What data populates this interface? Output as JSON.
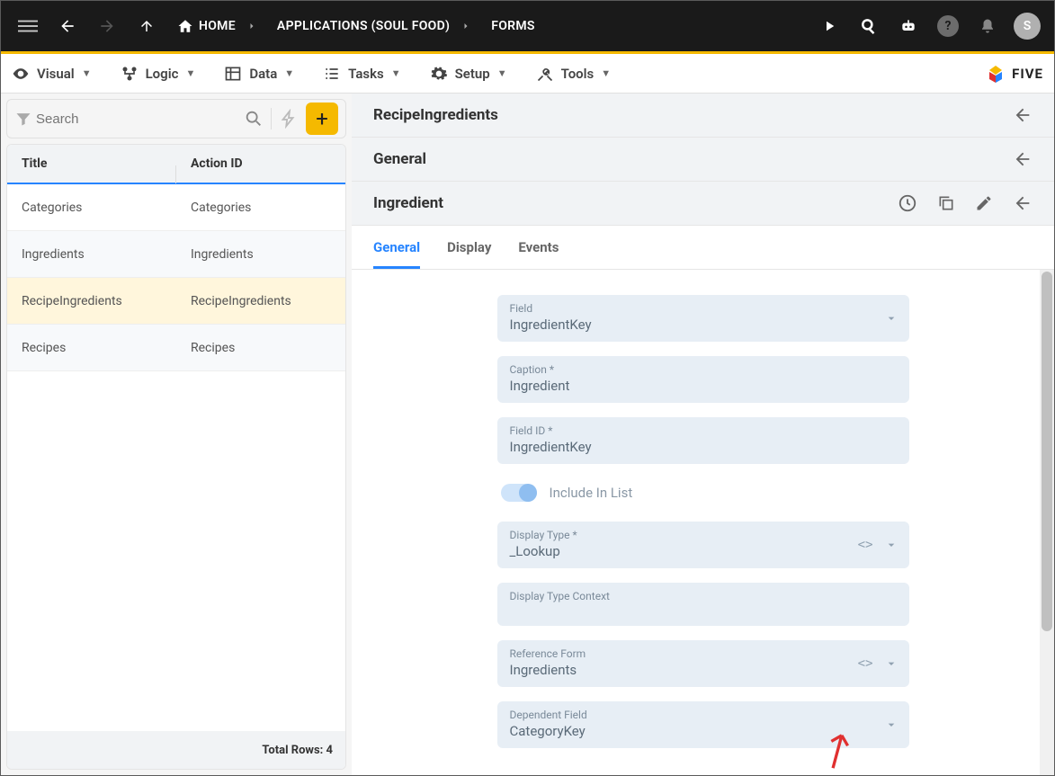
{
  "topbar": {
    "home_label": "HOME",
    "bc1": "APPLICATIONS (SOUL FOOD)",
    "bc2": "FORMS",
    "avatar_initial": "S"
  },
  "toolbar": {
    "visual": "Visual",
    "logic": "Logic",
    "data": "Data",
    "tasks": "Tasks",
    "setup": "Setup",
    "tools": "Tools",
    "brand": "FIVE"
  },
  "sidebar": {
    "search_placeholder": "Search",
    "cols": {
      "title": "Title",
      "action": "Action ID"
    },
    "rows": [
      {
        "title": "Categories",
        "action": "Categories"
      },
      {
        "title": "Ingredients",
        "action": "Ingredients"
      },
      {
        "title": "RecipeIngredients",
        "action": "RecipeIngredients"
      },
      {
        "title": "Recipes",
        "action": "Recipes"
      }
    ],
    "footer": "Total Rows: 4"
  },
  "detail": {
    "level1": "RecipeIngredients",
    "level2": "General",
    "level3": "Ingredient",
    "tabs": {
      "general": "General",
      "display": "Display",
      "events": "Events"
    },
    "fields": {
      "field_label": "Field",
      "field_value": "IngredientKey",
      "caption_label": "Caption *",
      "caption_value": "Ingredient",
      "fieldid_label": "Field ID *",
      "fieldid_value": "IngredientKey",
      "include_label": "Include In List",
      "displaytype_label": "Display Type *",
      "displaytype_value": "_Lookup",
      "context_label": "Display Type Context",
      "refform_label": "Reference Form",
      "refform_value": "Ingredients",
      "depfield_label": "Dependent Field",
      "depfield_value": "CategoryKey"
    }
  }
}
